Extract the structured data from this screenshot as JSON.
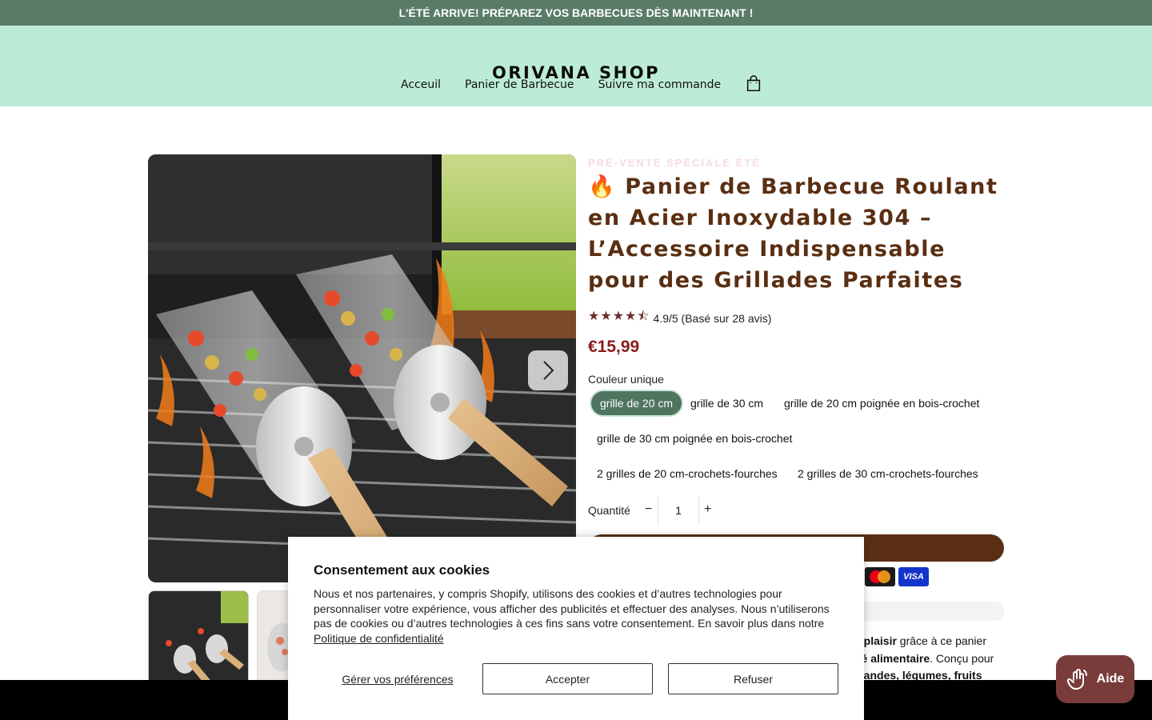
{
  "announcement": "L'ÉTÉ ARRIVE! PRÉPAREZ VOS BARBECUES DÈS MAINTENANT !",
  "header": {
    "brand": "ORIVANA SHOP",
    "nav": [
      "Acceuil",
      "Panier de Barbecue",
      "Suivre ma commande"
    ],
    "cart_icon": "shopping-bag-icon"
  },
  "product": {
    "badge": "PRÉ-VENTE SPÉCIALE ÉTÉ",
    "title": "🔥 Panier de Barbecue Roulant en Acier Inoxydable 304 – L’Accessoire Indispensable pour des Grillades Parfaites",
    "rating_stars": "★★★★⯪",
    "rating_value": 4.9,
    "rating_text": "4.9/5 (Basé sur 28 avis)",
    "price": "€15,99",
    "variant_label": "Couleur unique",
    "variants": [
      "grille de 20 cm",
      "grille de 30 cm",
      "grille de 20 cm poignée en bois-crochet",
      "grille de 30 cm poignée en bois-crochet",
      "2 grilles de 20 cm-crochets-fourches",
      "2 grilles de 30 cm-crochets-fourches"
    ],
    "selected_variant": "grille de 20 cm",
    "quantity_label": "Quantité",
    "quantity": "1",
    "minus": "−",
    "plus": "+",
    "payment": {
      "visa": "VISA",
      "mastercard_icon": "mastercard-icon"
    },
    "description_fragments": [
      {
        "before": "",
        "bold": "e plaisir",
        "after": " grâce à ce panier"
      },
      {
        "before": "",
        "bold": "ité alimentaire",
        "after": ". Conçu pour"
      },
      {
        "before": "",
        "bold": "viandes, légumes, fruits",
        "after": ""
      }
    ]
  },
  "cookie": {
    "title": "Consentement aux cookies",
    "body": "Nous et nos partenaires, y compris Shopify, utilisons des cookies et d’autres technologies pour personnaliser votre expérience, vous afficher des publicités et effectuer des analyses. Nous n’utiliserons pas de cookies ou d’autres technologies à ces fins sans votre consentement. En savoir plus dans notre",
    "policy_link": "Politique de confidentialité",
    "manage": "Gérer vos préférences",
    "accept": "Accepter",
    "refuse": "Refuser"
  },
  "chat": {
    "label": "Aide"
  },
  "colors": {
    "announcement_bg": "#5a7b68",
    "header_bg": "#bdecd6",
    "title": "#5a2e12",
    "price": "#8b1b1b",
    "variant_active": "#4f7560",
    "chat_bg": "#7a3b3b"
  }
}
